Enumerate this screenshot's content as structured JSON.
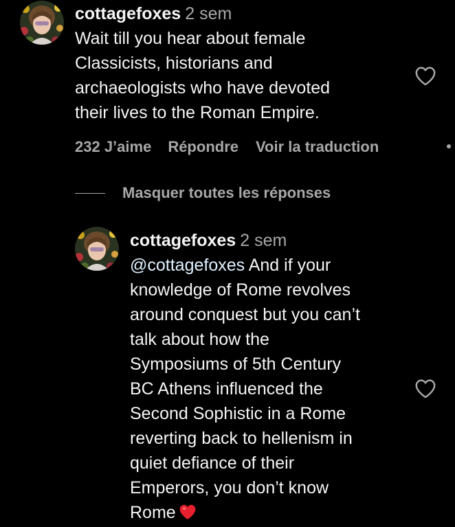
{
  "comment": {
    "username": "cottagefoxes",
    "time": "2 sem",
    "text_lines": [
      "Wait till you hear about female",
      "Classicists, historians and",
      "archaeologists who have devoted",
      "their lives to the Roman Empire."
    ],
    "actions": {
      "likes": "232 J’aime",
      "reply": "Répondre",
      "translate": "Voir la traduction"
    }
  },
  "hide_replies": "Masquer toutes les réponses",
  "reply": {
    "username": "cottagefoxes",
    "time": "2 sem",
    "mention": "@cottagefoxes",
    "first_line_rest": " And if your",
    "text_lines": [
      "knowledge of Rome revolves",
      "around conquest but you can’t",
      "talk about how the",
      "Symposiums of 5th Century",
      "BC Athens influenced the",
      "Second Sophistic in a Rome",
      "reverting back to hellenism in",
      "quiet defiance of their",
      "Emperors, you don’t know"
    ],
    "last_line": "Rome"
  },
  "icons": {
    "like": "heart-outline-icon",
    "emoji": "red-heart-emoji-icon",
    "more": "more-dot-icon"
  },
  "colors": {
    "background": "#000000",
    "text": "#f5f5f5",
    "secondary": "#a8a8a8",
    "emoji_red": "#e8202e"
  }
}
